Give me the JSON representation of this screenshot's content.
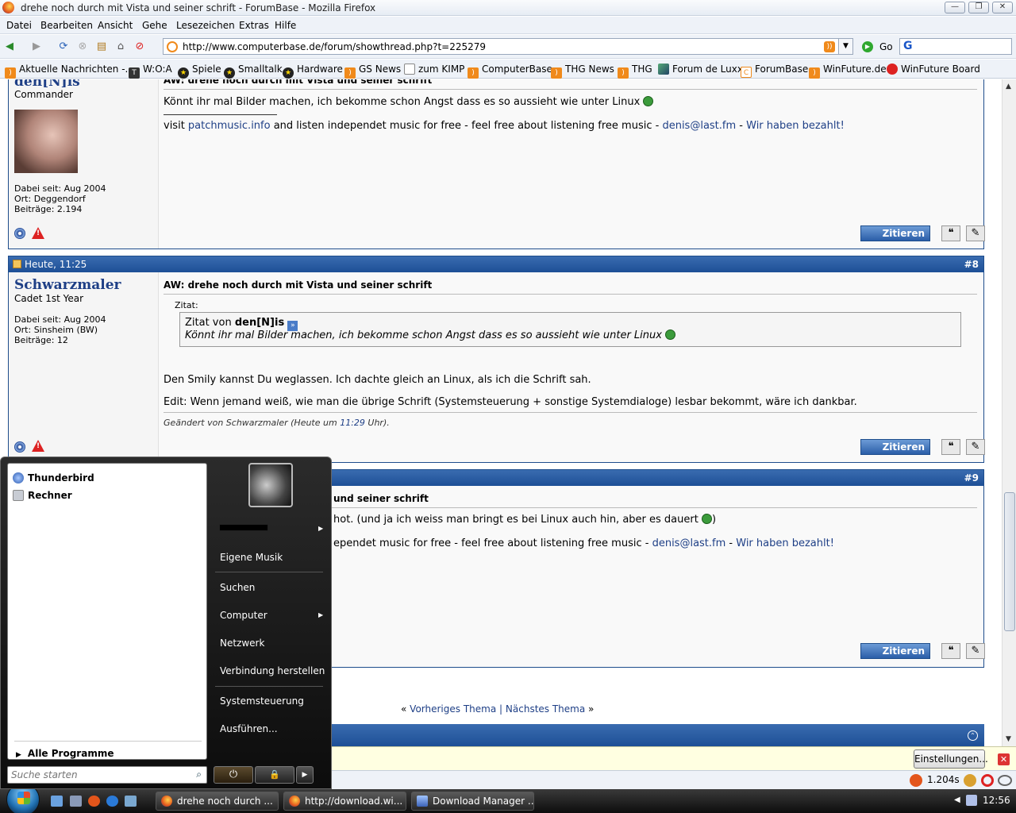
{
  "window": {
    "title": "drehe noch durch mit Vista und seiner schrift - ForumBase - Mozilla Firefox",
    "min": "—",
    "max": "❐",
    "close": "✕"
  },
  "menu": [
    "Datei",
    "Bearbeiten",
    "Ansicht",
    "Gehe",
    "Lesezeichen",
    "Extras",
    "Hilfe"
  ],
  "nav": {
    "url": "http://www.computerbase.de/forum/showthread.php?t=225279",
    "go": "Go",
    "search_glyph": "G"
  },
  "bookmarks": [
    {
      "label": "Aktuelle Nachrichten -...",
      "icon": "rss-icon"
    },
    {
      "label": "W:O:A",
      "icon": "t-icon"
    },
    {
      "label": "Spiele",
      "icon": "star-icon"
    },
    {
      "label": "Smalltalk",
      "icon": "star-icon"
    },
    {
      "label": "Hardware",
      "icon": "star-icon"
    },
    {
      "label": "GS News",
      "icon": "rss-icon"
    },
    {
      "label": "zum KIMP",
      "icon": "doc-icon"
    },
    {
      "label": "ComputerBase",
      "icon": "rss-icon"
    },
    {
      "label": "THG News",
      "icon": "rss-icon"
    },
    {
      "label": "THG",
      "icon": "rss-icon"
    },
    {
      "label": "Forum de Luxx",
      "icon": "luxx-icon"
    },
    {
      "label": "ForumBase",
      "icon": "cb-icon"
    },
    {
      "label": "WinFuture.de",
      "icon": "rss-icon"
    },
    {
      "label": "WinFuture Board",
      "icon": "wf-icon"
    }
  ],
  "posts": [
    {
      "user": "den[N]is",
      "rank": "Commander",
      "since": "Dabei seit: Aug 2004",
      "location": "Ort: Deggendorf",
      "count": "Beiträge: 2.194",
      "title": "AW: drehe noch durch mit Vista und seiner schrift",
      "body": "Könnt ihr mal Bilder machen, ich bekomme schon Angst dass es so aussieht wie unter Linux",
      "sig_pre": "visit ",
      "sig_link1": "patchmusic.info",
      "sig_mid": " and listen independet music for free - feel free about listening free music - ",
      "sig_link2": "denis@last.fm",
      "sig_sep": " - ",
      "sig_link3": "Wir haben bezahlt!",
      "quote_btn": "Zitieren"
    },
    {
      "date": "Heute, 11:25",
      "num": "#8",
      "user": "Schwarzmaler",
      "rank": "Cadet 1st Year",
      "since": "Dabei seit: Aug 2004",
      "location": "Ort: Sinsheim (BW)",
      "count": "Beiträge: 12",
      "title": "AW: drehe noch durch mit Vista und seiner schrift",
      "quote_label": "Zitat:",
      "quote_from": "Zitat von ",
      "quote_user": "den[N]is",
      "quote_text": "Könnt ihr mal Bilder machen, ich bekomme schon Angst dass es so aussieht wie unter Linux",
      "body1": "Den Smily kannst Du weglassen. Ich dachte gleich an Linux, als ich die Schrift sah.",
      "body2": "Edit: Wenn jemand weiß, wie man die übrige Schrift (Systemsteuerung + sonstige Systemdialoge) lesbar bekommt, wäre ich dankbar.",
      "edited_pre": "Geändert von Schwarzmaler (Heute um ",
      "edited_time": "11:29",
      "edited_post": " Uhr).",
      "quote_btn": "Zitieren"
    },
    {
      "num": "#9",
      "title_visible": "und seiner schrift",
      "body_visible": "hot. (und ja ich weiss man bringt es bei Linux auch hin, aber es dauert",
      "body_end": ")",
      "sig_visible": "ependet music for free - feel free about listening free music - ",
      "sig_link2": "denis@last.fm",
      "sig_sep": " - ",
      "sig_link3": "Wir haben bezahlt!",
      "quote_btn": "Zitieren"
    }
  ],
  "thread_nav": {
    "left": "«",
    "prev": "Vorheriges Thema",
    "sep": "|",
    "next": "Nächstes Thema",
    "right": "»"
  },
  "notify": {
    "button": "Einstellungen..."
  },
  "status": {
    "time": "1.204s"
  },
  "startmenu": {
    "pinned": [
      {
        "label": "Thunderbird"
      },
      {
        "label": "Rechner"
      }
    ],
    "all_programs": "Alle Programme",
    "search_placeholder": "Suche starten",
    "right": [
      {
        "label": "Eigene Musik"
      },
      {
        "label": "Suchen"
      },
      {
        "label": "Computer"
      },
      {
        "label": "Netzwerk"
      },
      {
        "label": "Verbindung herstellen"
      },
      {
        "label": "Systemsteuerung"
      },
      {
        "label": "Ausführen..."
      }
    ]
  },
  "taskbar": {
    "items": [
      {
        "label": "drehe noch durch ..."
      },
      {
        "label": "http://download.wi..."
      },
      {
        "label": "Download Manager ..."
      }
    ],
    "clock": "12:56"
  }
}
